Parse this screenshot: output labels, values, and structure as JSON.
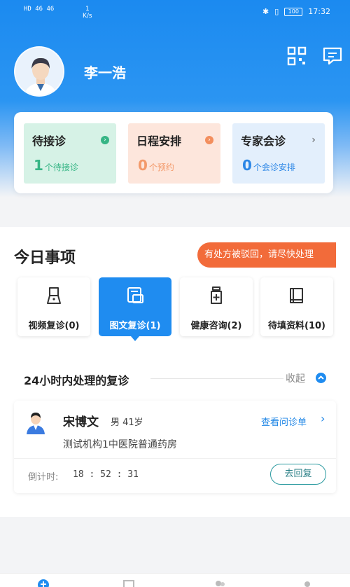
{
  "status_bar": {
    "network": "HD 46 46",
    "speed": "1\nK/s",
    "battery": "100",
    "time": "17:32"
  },
  "profile": {
    "name": "李一浩"
  },
  "header_icons": [
    "qr-code-icon",
    "message-icon"
  ],
  "summary": {
    "pending": {
      "title": "待接诊",
      "count": "1",
      "suffix": "个待接诊"
    },
    "schedule": {
      "title": "日程安排",
      "count": "0",
      "suffix": "个预约"
    },
    "consult": {
      "title": "专家会诊",
      "count": "0",
      "suffix": "个会诊安排"
    }
  },
  "today": {
    "title": "今日事项",
    "alert": "有处方被驳回，请尽快处理",
    "categories": [
      {
        "label": "视频复诊(0)",
        "icon": "video-followup-icon"
      },
      {
        "label": "图文复诊(1)",
        "icon": "image-text-icon"
      },
      {
        "label": "健康咨询(2)",
        "icon": "health-bottle-icon"
      },
      {
        "label": "待填资料(10)",
        "icon": "book-icon"
      }
    ],
    "section_title": "24小时内处理的复诊",
    "collapse_label": "收起"
  },
  "patient": {
    "name": "宋博文",
    "meta": "男 41岁",
    "view_label": "查看问诊单",
    "org": "测试机构1中医院普通药房",
    "countdown_label": "倒计时:",
    "countdown_value": "18 : 52 : 31",
    "reply_label": "去回复"
  },
  "colors": {
    "primary": "#1f8cf0",
    "alert": "#f26b3a",
    "green": "#36b585",
    "orange": "#f39a6b"
  }
}
